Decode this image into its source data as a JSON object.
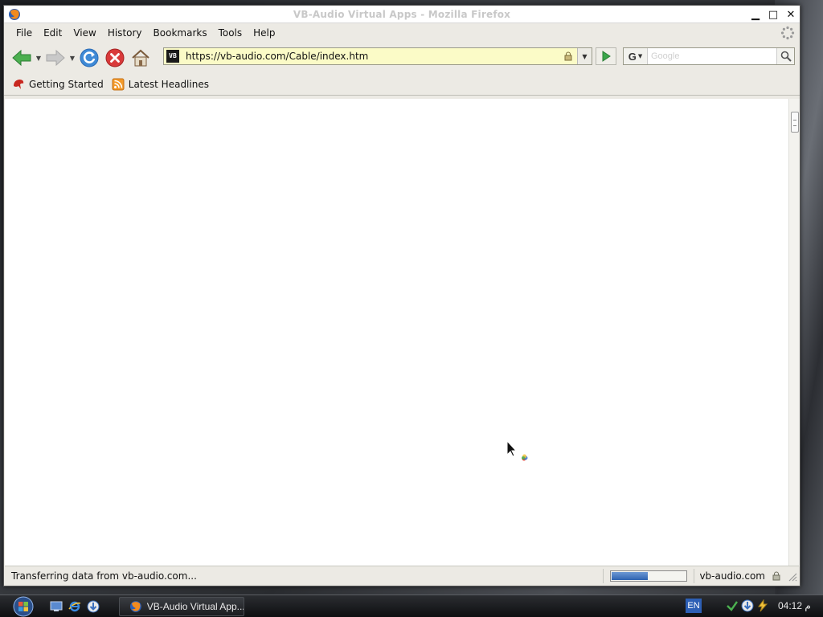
{
  "window": {
    "title": "VB-Audio Virtual Apps - Mozilla Firefox",
    "minimize": "▁",
    "maximize": "□",
    "close": "✕"
  },
  "menu": {
    "items": [
      {
        "label": "File"
      },
      {
        "label": "Edit"
      },
      {
        "label": "View"
      },
      {
        "label": "History"
      },
      {
        "label": "Bookmarks"
      },
      {
        "label": "Tools"
      },
      {
        "label": "Help"
      }
    ]
  },
  "navbar": {
    "url": "https://vb-audio.com/Cable/index.htm",
    "site_icon_text": "VB",
    "search_placeholder": "Google",
    "search_engine_letter": "G"
  },
  "bookmarks": {
    "items": [
      {
        "label": "Getting Started"
      },
      {
        "label": "Latest Headlines"
      }
    ]
  },
  "status": {
    "text": "Transferring data from vb-audio.com...",
    "domain": "vb-audio.com",
    "progress": 0.5
  },
  "taskbar": {
    "task_label": "VB-Audio Virtual App...",
    "language": "EN",
    "clock": "04:12 م"
  },
  "colors": {
    "urlbar_bg": "#fbfbc7",
    "progress_fill": "#3a6fbf",
    "back_arrow": "#3aa64a",
    "stop": "#d93a3a"
  }
}
